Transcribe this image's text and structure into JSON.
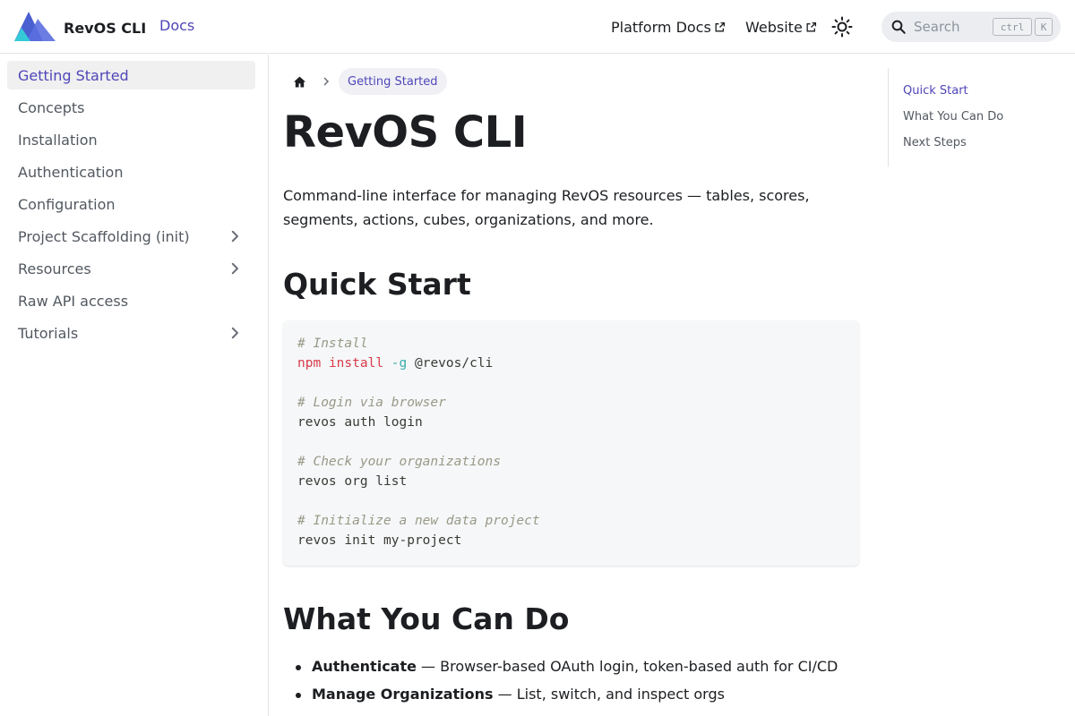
{
  "navbar": {
    "brand_title": "RevOS CLI",
    "docs_label": "Docs",
    "platform_docs_label": "Platform Docs",
    "website_label": "Website",
    "search_placeholder": "Search",
    "shortcut_ctrl": "ctrl",
    "shortcut_key": "K"
  },
  "sidebar": {
    "items": [
      {
        "label": "Getting Started",
        "active": true
      },
      {
        "label": "Concepts"
      },
      {
        "label": "Installation"
      },
      {
        "label": "Authentication"
      },
      {
        "label": "Configuration"
      },
      {
        "label": "Project Scaffolding (init)",
        "expandable": true
      },
      {
        "label": "Resources",
        "expandable": true
      },
      {
        "label": "Raw API access"
      },
      {
        "label": "Tutorials",
        "expandable": true
      }
    ]
  },
  "breadcrumb": {
    "current": "Getting Started"
  },
  "main": {
    "title": "RevOS CLI",
    "intro": "Command-line interface for managing RevOS resources — tables, scores, segments, actions, cubes, organizations, and more.",
    "quick_start_heading": "Quick Start",
    "code": {
      "c1": "# Install",
      "l1_cmd": "npm",
      "l1_sub": "install",
      "l1_flag": "-g",
      "l1_arg": "@revos/cli",
      "c2": "# Login via browser",
      "l2": "revos auth login",
      "c3": "# Check your organizations",
      "l3": "revos org list",
      "c4": "# Initialize a new data project",
      "l4": "revos init my-project"
    },
    "what_heading": "What You Can Do",
    "capabilities": [
      {
        "title": "Authenticate",
        "desc": " — Browser-based OAuth login, token-based auth for CI/CD"
      },
      {
        "title": "Manage Organizations",
        "desc": " — List, switch, and inspect orgs"
      }
    ]
  },
  "toc": {
    "items": [
      {
        "label": "Quick Start",
        "active": true
      },
      {
        "label": "What You Can Do"
      },
      {
        "label": "Next Steps"
      }
    ]
  },
  "colors": {
    "accent": "#4f46b8",
    "logo_blue": "#4a5fd0",
    "logo_teal": "#33c9d6"
  },
  "icons": [
    "logo-icon",
    "external-link-icon",
    "sun-icon",
    "search-icon",
    "home-icon",
    "chevron-right-icon"
  ]
}
